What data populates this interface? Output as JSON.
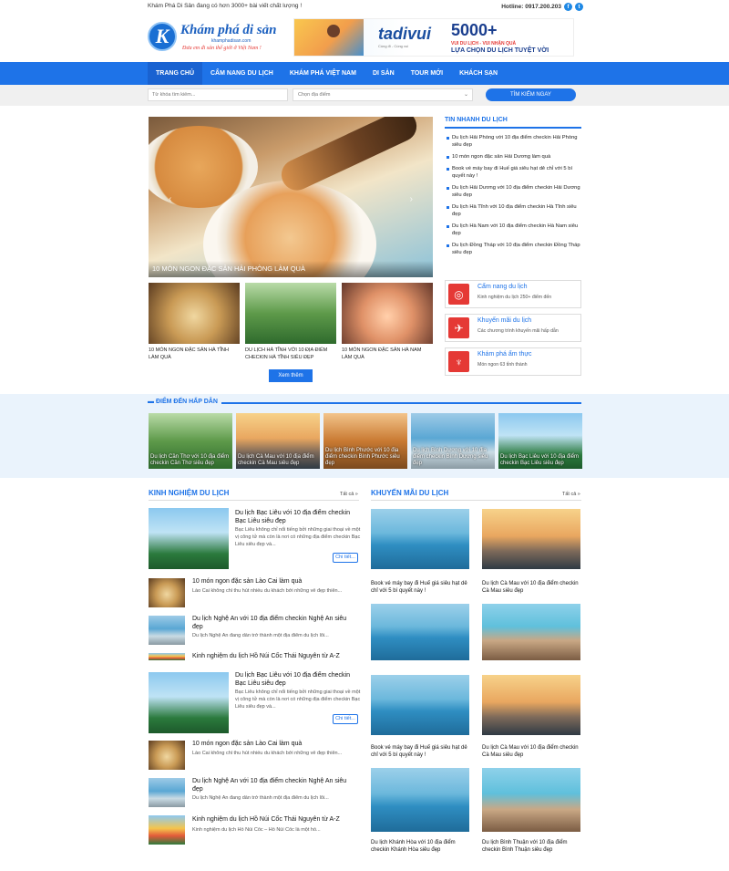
{
  "topbar": {
    "tagline": "Khám Phá Di Sản đang có hơn 3000+ bài viết chất lượng !",
    "hotline": "Hotline: 0917.200.203"
  },
  "logo": {
    "letter": "K",
    "name": "Khám phá di sản",
    "domain": "khamphadisan.com",
    "slogan": "Đưa em đi sản thế giới ở Việt Nam !"
  },
  "banner": {
    "brand": "tadivui",
    "brand_sub": "Cùng đi - Cùng vui",
    "headline": "5000+",
    "line1": "VUI DU LỊCH - VUI NHẬN QUÀ",
    "line2": "LỰA CHỌN DU LỊCH TUYỆT VỜI"
  },
  "nav": [
    "TRANG CHỦ",
    "CẨM NANG DU LỊCH",
    "KHÁM PHÁ VIỆT NAM",
    "DI SẢN",
    "TOUR MỚI",
    "KHÁCH SẠN"
  ],
  "search": {
    "placeholder": "Từ khóa tìm kiếm...",
    "location": "Chọn địa điểm",
    "button": "TÌM KIẾM NGAY"
  },
  "hero": {
    "caption": "10 MÓN NGON ĐẶC SẢN HẢI PHÒNG LÀM QUÀ"
  },
  "thumbs": [
    "10 MÓN NGON ĐẶC SẢN HÀ TĨNH LÀM QUÀ",
    "DU LỊCH HÀ TĨNH VỚI 10 ĐỊA ĐIỂM CHECKIN HÀ TĨNH SIÊU ĐẸP",
    "10 MÓN NGON ĐẶC SẢN HÀ NAM LÀM QUÀ"
  ],
  "more_button": "Xem thêm",
  "tin_nhanh": {
    "title": "TIN NHANH DU LỊCH",
    "items": [
      "Du lịch Hải Phòng với 10 địa điểm checkin Hải Phòng siêu đẹp",
      "10 món ngon đặc sản Hải Dương làm quà",
      "Book vé máy bay đi Huế giá siêu hạt dẻ chỉ với 5 bí quyết này !",
      "Du lịch Hải Dương với 10 địa điểm checkin Hải Dương siêu đẹp",
      "Du lịch Hà Tĩnh với 10 địa điểm checkin Hà Tĩnh siêu đẹp",
      "Du lịch Hà Nam với 10 địa điểm checkin Hà Nam siêu đẹp",
      "Du lịch Đồng Tháp với 10 địa điểm checkin Đồng Tháp siêu đẹp"
    ]
  },
  "boxes": [
    {
      "title": "Cẩm nang du lịch",
      "sub": "Kinh nghiệm du lịch 250+ điểm đến"
    },
    {
      "title": "Khuyến mãi du lịch",
      "sub": "Các chương trình khuyến mãi hấp dẫn"
    },
    {
      "title": "Khám phá ẩm thực",
      "sub": "Món ngon 63 tỉnh thành"
    }
  ],
  "destinations": {
    "title": "ĐIỂM ĐẾN HẤP DẪN",
    "items": [
      "Du lịch Cần Thơ với 10 địa điểm checkin Cần Thơ siêu đẹp",
      "Du lịch Cà Mau với 10 địa điểm checkin Cà Mau siêu đẹp",
      "Du lịch Bình Phước với 10 địa điểm checkin Bình Phước siêu đẹp",
      "Du lịch Bình Dương với 10 địa điểm checkin Bình Dương siêu đẹp",
      "Du lịch Bạc Liêu với 10 địa điểm checkin Bạc Liêu siêu đẹp"
    ]
  },
  "kinh_nghiem": {
    "title": "KINH NGHIỆM DU LỊCH",
    "all": "Tất cả »",
    "read_more": "Chi tiết...",
    "featured": {
      "title": "Du lịch Bạc Liêu với 10 địa điểm checkin Bạc Liêu siêu đẹp",
      "desc": "Bạc Liêu không chỉ nổi tiếng bởi những giai thoại về một vị công tử mà còn là nơi có những địa điểm checkin Bạc Liêu siêu đẹp và..."
    },
    "items": [
      {
        "title": "10 món ngon đặc sản Lào Cai làm quà",
        "desc": "Lào Cai không chỉ thu hút nhiều du khách bởi những vẻ đẹp thiên..."
      },
      {
        "title": "Du lịch Nghệ An với 10 địa điểm checkin Nghệ An siêu đẹp",
        "desc": "Du lịch Nghệ An đang dần trở thành một địa điểm du lịch lôi..."
      },
      {
        "title": "Kinh nghiệm du lịch Hồ Núi Cốc Thái Nguyên từ A-Z",
        "desc": "Kinh nghiệm du lịch Hồ Núi Cốc – Hồ Núi Cốc là một hồ..."
      }
    ]
  },
  "khuyen_mai": {
    "title": "KHUYẾN MÃI DU LỊCH",
    "all": "Tất cả »",
    "items": [
      "Book vé máy bay đi Huế giá siêu hạt dẻ chỉ với 5 bí quyết này !",
      "Du lịch Cà Mau với 10 địa điểm checkin Cà Mau siêu đẹp",
      "Du lịch Khánh Hòa với 10 địa điểm checkin Khánh Hòa siêu đẹp",
      "Du lịch Bình Thuận với 10 địa điểm checkin Bình Thuận siêu đẹp"
    ]
  },
  "colors": {
    "primary": "#1e73e8",
    "accent": "#e53935"
  }
}
